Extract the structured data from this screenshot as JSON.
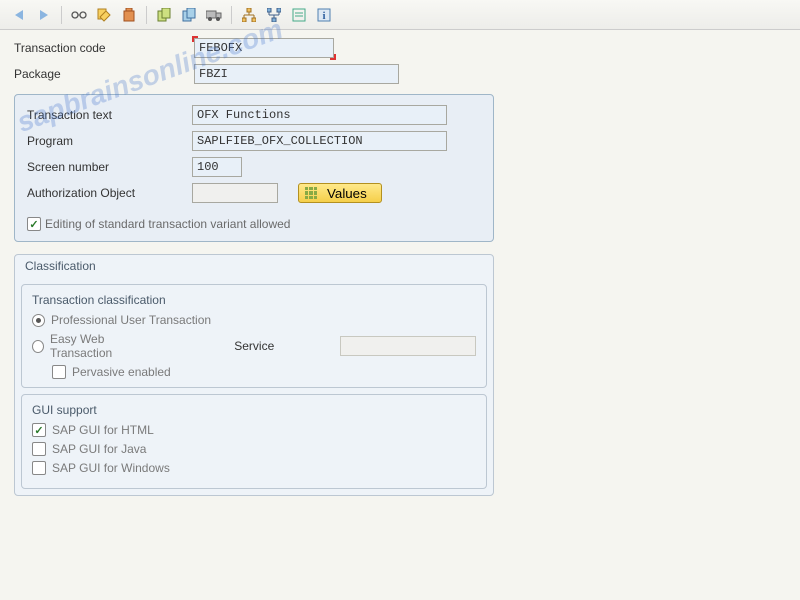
{
  "toolbar": {},
  "header": {
    "tcode_label": "Transaction code",
    "tcode_value": "FEBOFX",
    "package_label": "Package",
    "package_value": "FBZI"
  },
  "details": {
    "text_label": "Transaction text",
    "text_value": "OFX Functions",
    "program_label": "Program",
    "program_value": "SAPLFIEB_OFX_COLLECTION",
    "screen_label": "Screen number",
    "screen_value": "100",
    "auth_label": "Authorization Object",
    "auth_value": "",
    "values_btn": "Values",
    "edit_variant_label": "Editing of standard transaction variant allowed",
    "edit_variant_checked": true
  },
  "classification": {
    "title": "Classification",
    "trans_class": {
      "title": "Transaction classification",
      "professional": "Professional User Transaction",
      "easy": "Easy Web Transaction",
      "service_label": "Service",
      "pervasive": "Pervasive enabled"
    },
    "gui": {
      "title": "GUI support",
      "html": "SAP GUI for HTML",
      "java": "SAP GUI for Java",
      "windows": "SAP GUI for Windows"
    }
  },
  "watermark": "sapbrainsonline.com"
}
